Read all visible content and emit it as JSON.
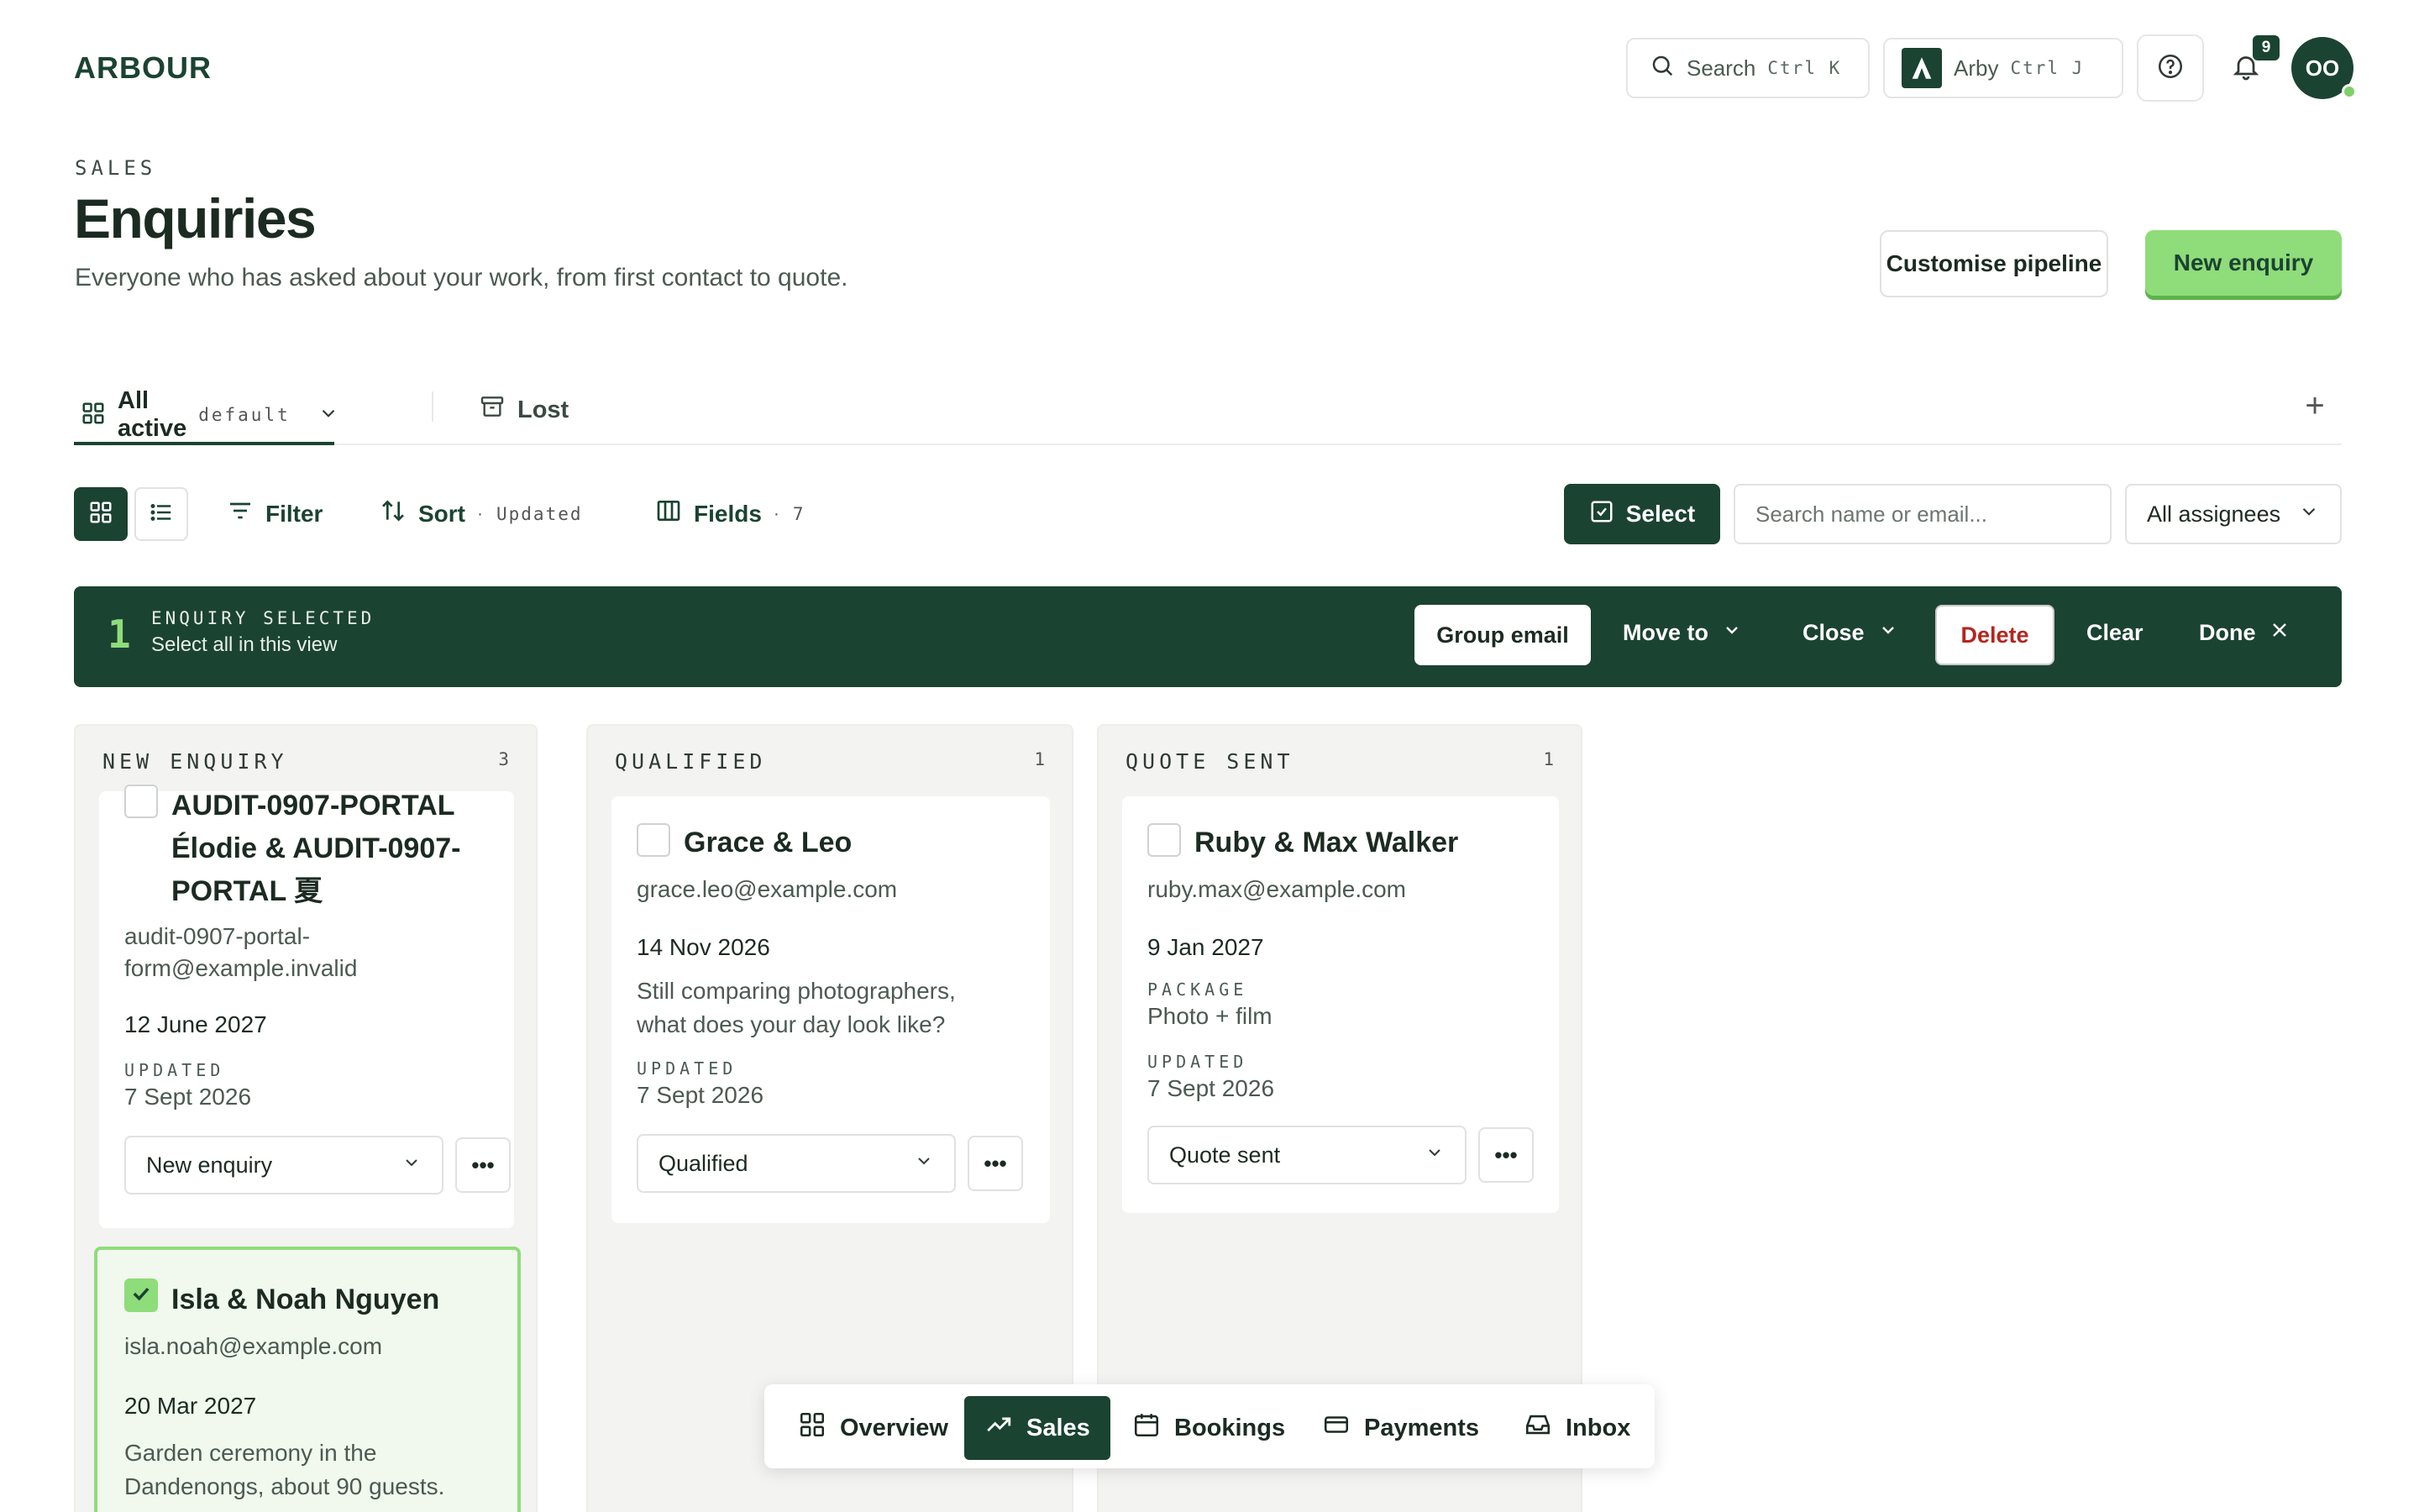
{
  "header": {
    "logo": "ARBOUR",
    "search_label": "Search",
    "search_shortcut": "Ctrl K",
    "assistant_label": "Arby",
    "assistant_shortcut": "Ctrl J",
    "notifications_count": "9",
    "avatar_initials": "OO"
  },
  "page": {
    "eyebrow": "SALES",
    "title": "Enquiries",
    "subtitle": "Everyone who has asked about your work, from first contact to quote.",
    "customise_label": "Customise pipeline",
    "new_label": "New enquiry"
  },
  "tabs": {
    "active_label": "All active",
    "active_badge": "default",
    "lost_label": "Lost",
    "add_symbol": "+"
  },
  "toolbar": {
    "filter_label": "Filter",
    "sort_label": "Sort",
    "sort_value": "Updated",
    "fields_label": "Fields",
    "fields_count": "7",
    "select_label": "Select",
    "search_placeholder": "Search name or email...",
    "assignees_label": "All assignees"
  },
  "selection": {
    "count": "1",
    "label": "ENQUIRY SELECTED",
    "select_all": "Select all in this view",
    "group_email": "Group email",
    "move_to": "Move to",
    "close": "Close",
    "delete": "Delete",
    "clear": "Clear",
    "done": "Done"
  },
  "columns": [
    {
      "title": "NEW ENQUIRY",
      "count": "3",
      "cards": [
        {
          "name_line1": "AUDIT-0907-PORTAL",
          "name_line2": "Élodie & AUDIT-0907-",
          "name_line3": "PORTAL 夏",
          "email_line1": "audit-0907-portal-",
          "email_line2": "form@example.invalid",
          "date": "12 June 2027",
          "updated_label": "UPDATED",
          "updated": "7 Sept 2026",
          "status": "New enquiry",
          "more": "•••"
        },
        {
          "name": "Isla & Noah Nguyen",
          "email": "isla.noah@example.com",
          "date": "20 Mar 2027",
          "note_line1": "Garden ceremony in the",
          "note_line2": "Dandenongs, about 90 guests.",
          "selected": true
        }
      ]
    },
    {
      "title": "QUALIFIED",
      "count": "1",
      "cards": [
        {
          "name": "Grace & Leo",
          "email": "grace.leo@example.com",
          "date": "14 Nov 2026",
          "note_line1": "Still comparing photographers,",
          "note_line2": "what does your day look like?",
          "updated_label": "UPDATED",
          "updated": "7 Sept 2026",
          "status": "Qualified",
          "more": "•••"
        }
      ]
    },
    {
      "title": "QUOTE SENT",
      "count": "1",
      "cards": [
        {
          "name": "Ruby & Max Walker",
          "email": "ruby.max@example.com",
          "date": "9 Jan 2027",
          "package_label": "PACKAGE",
          "package": "Photo + film",
          "updated_label": "UPDATED",
          "updated": "7 Sept 2026",
          "status": "Quote sent",
          "more": "•••"
        }
      ]
    }
  ],
  "bottom_nav": [
    {
      "label": "Overview",
      "icon": "grid-icon"
    },
    {
      "label": "Sales",
      "icon": "trend-icon",
      "active": true
    },
    {
      "label": "Bookings",
      "icon": "calendar-icon"
    },
    {
      "label": "Payments",
      "icon": "card-icon"
    },
    {
      "label": "Inbox",
      "icon": "inbox-icon"
    }
  ],
  "colors": {
    "brand": "#1b4332",
    "accent": "#8fdc7a",
    "danger": "#b3261e"
  }
}
